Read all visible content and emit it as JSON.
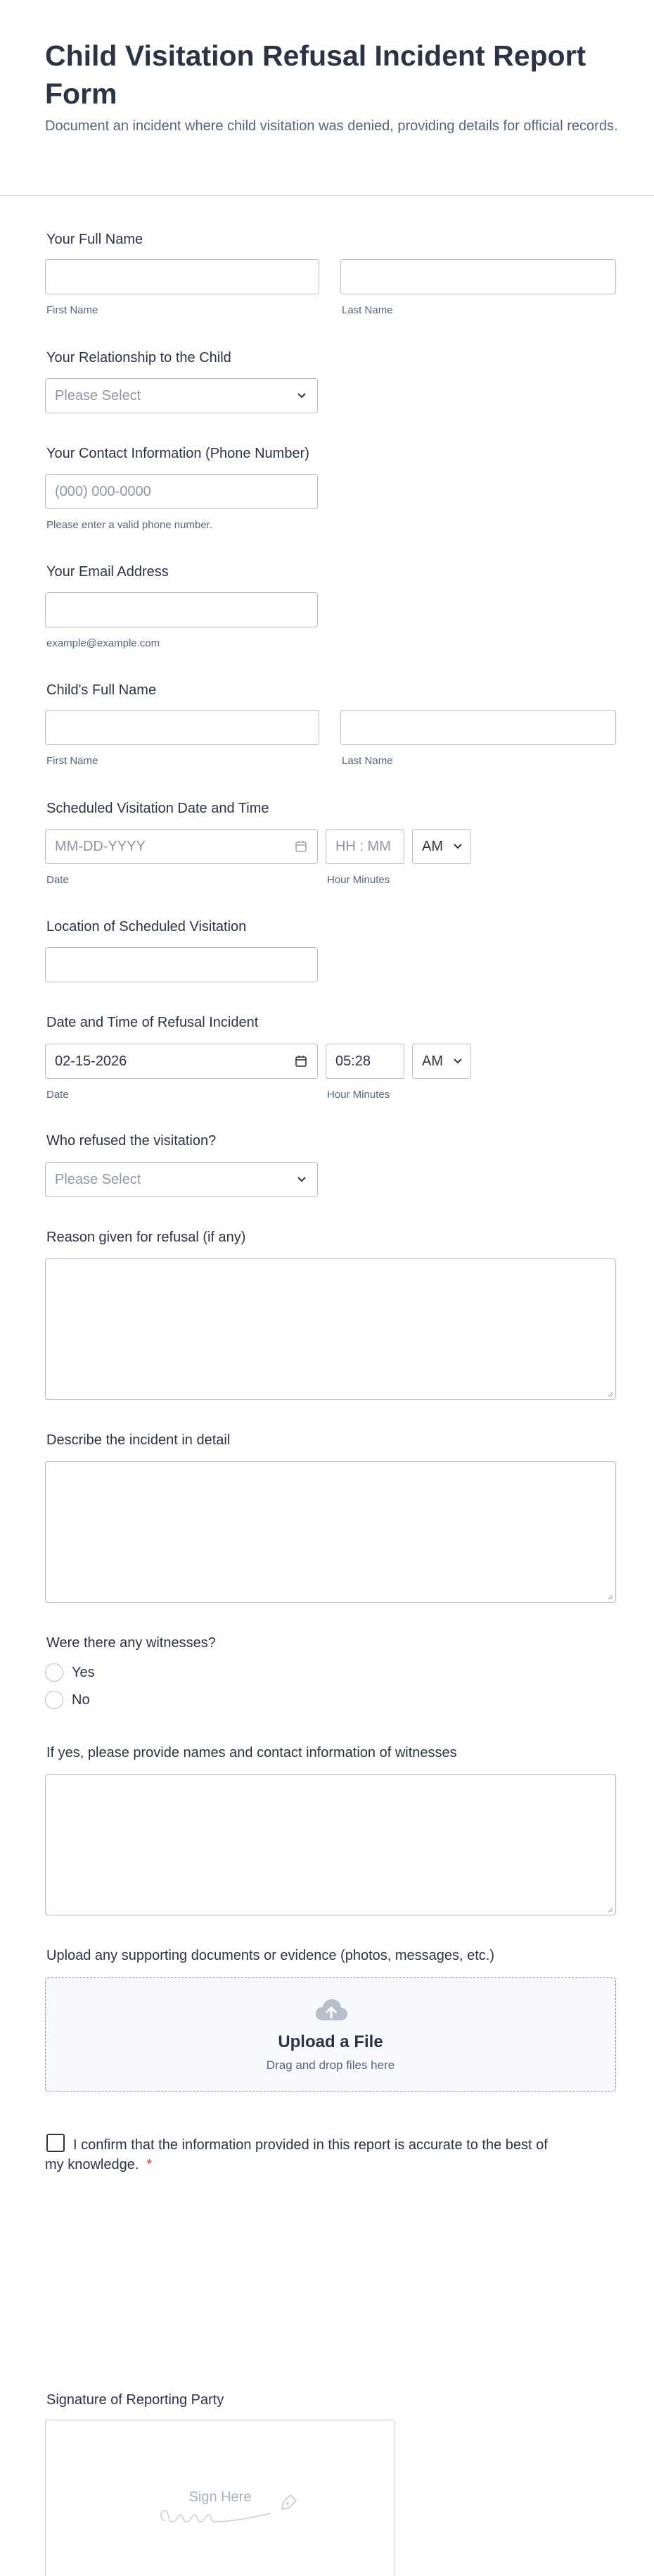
{
  "form": {
    "title": "Child Visitation Refusal Incident Report Form",
    "description": "Document an incident where child visitation was denied, providing details for official records."
  },
  "fields": {
    "full_name": {
      "label": "Your Full Name",
      "first_sub": "First Name",
      "last_sub": "Last Name",
      "first_value": "",
      "last_value": ""
    },
    "relationship": {
      "label": "Your Relationship to the Child",
      "placeholder": "Please Select"
    },
    "phone": {
      "label": "Your Contact Information (Phone Number)",
      "placeholder": "(000) 000-0000",
      "sub": "Please enter a valid phone number."
    },
    "email": {
      "label": "Your Email Address",
      "value": "",
      "sub": "example@example.com"
    },
    "child_name": {
      "label": "Child's Full Name",
      "first_sub": "First Name",
      "last_sub": "Last Name",
      "first_value": "",
      "last_value": ""
    },
    "scheduled": {
      "label": "Scheduled Visitation Date and Time",
      "date_placeholder": "MM-DD-YYYY",
      "time_placeholder": "HH : MM",
      "ampm": "AM",
      "date_sub": "Date",
      "time_sub": "Hour Minutes"
    },
    "location": {
      "label": "Location of Scheduled Visitation",
      "value": ""
    },
    "refusal": {
      "label": "Date and Time of Refusal Incident",
      "date_value": "02-15-2026",
      "time_value": "05:28",
      "ampm": "AM",
      "date_sub": "Date",
      "time_sub": "Hour Minutes"
    },
    "who_refused": {
      "label": "Who refused the visitation?",
      "placeholder": "Please Select"
    },
    "reason": {
      "label": "Reason given for refusal (if any)",
      "value": ""
    },
    "describe": {
      "label": "Describe the incident in detail",
      "value": ""
    },
    "witnesses": {
      "label": "Were there any witnesses?",
      "options": [
        "Yes",
        "No"
      ]
    },
    "witness_info": {
      "label": "If yes, please provide names and contact information of witnesses",
      "value": ""
    },
    "upload": {
      "label": "Upload any supporting documents or evidence (photos, messages, etc.)",
      "title": "Upload a File",
      "sub": "Drag and drop files here"
    },
    "confirm": {
      "text": "I confirm that the information provided in this report is accurate to the best of my knowledge.",
      "required_mark": "*"
    },
    "signature": {
      "label": "Signature of Reporting Party",
      "placeholder": "Sign Here"
    }
  },
  "icons": {
    "select": "chevron-down-icon",
    "date": "calendar-icon",
    "upload": "cloud-upload-icon",
    "signature": "pen-icon"
  },
  "colors": {
    "text": "#2c3345",
    "muted": "#57647e",
    "border": "#b8bdc9",
    "required": "#f23a3c",
    "upload_bg": "#f8f9fd"
  }
}
